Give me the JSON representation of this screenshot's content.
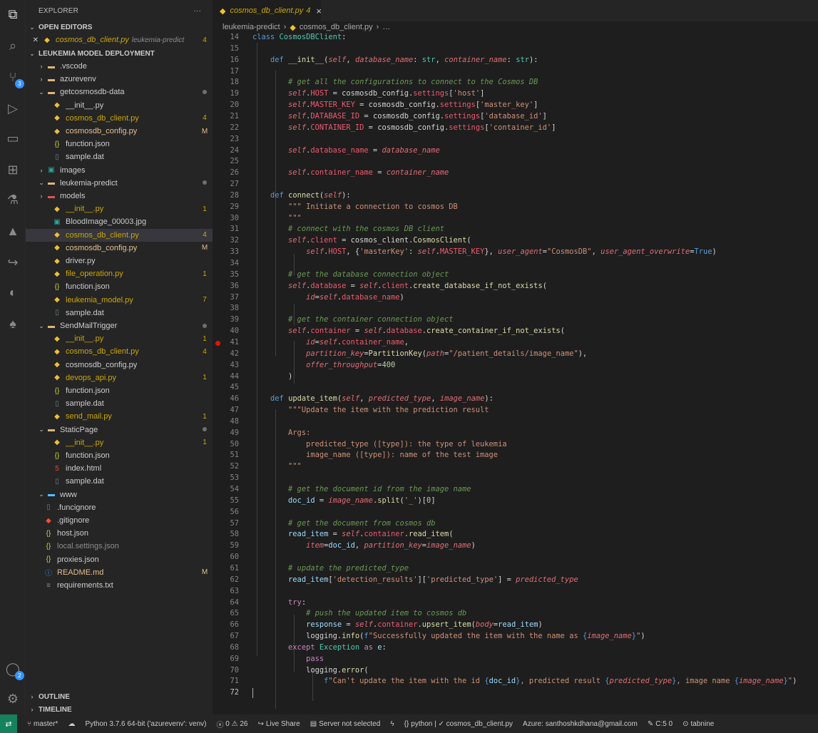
{
  "sidebar": {
    "title": "EXPLORER",
    "more": "···",
    "open_editors_label": "OPEN EDITORS",
    "open_editor": {
      "name": "cosmos_db_client.py",
      "desc": "leukemia-predict",
      "count": "4"
    },
    "project_label": "LEUKEMIA MODEL DEPLOYMENT",
    "outline_label": "OUTLINE",
    "timeline_label": "TIMELINE",
    "tree": [
      {
        "name": ".vscode",
        "type": "folder"
      },
      {
        "name": "azurevenv",
        "type": "folder"
      },
      {
        "name": "getcosmosdb-data",
        "type": "folder-open",
        "dec": "dot"
      },
      {
        "name": "__init__.py",
        "type": "py",
        "indent": 1
      },
      {
        "name": "cosmos_db_client.py",
        "type": "py",
        "indent": 1,
        "dec": "4"
      },
      {
        "name": "cosmosdb_config.py",
        "type": "py",
        "indent": 1,
        "dec": "M"
      },
      {
        "name": "function.json",
        "type": "json",
        "indent": 1
      },
      {
        "name": "sample.dat",
        "type": "file",
        "indent": 1
      },
      {
        "name": "images",
        "type": "img-folder"
      },
      {
        "name": "leukemia-predict",
        "type": "folder-open",
        "dec": "dot"
      },
      {
        "name": "models",
        "type": "red-folder",
        "indent": 1
      },
      {
        "name": "__init__.py",
        "type": "py",
        "indent": 1,
        "dec": "1"
      },
      {
        "name": "BloodImage_00003.jpg",
        "type": "img",
        "indent": 1
      },
      {
        "name": "cosmos_db_client.py",
        "type": "py",
        "indent": 1,
        "dec": "4",
        "sel": true
      },
      {
        "name": "cosmosdb_config.py",
        "type": "py",
        "indent": 1,
        "dec": "M"
      },
      {
        "name": "driver.py",
        "type": "py",
        "indent": 1
      },
      {
        "name": "file_operation.py",
        "type": "py",
        "indent": 1,
        "dec": "1"
      },
      {
        "name": "function.json",
        "type": "json",
        "indent": 1
      },
      {
        "name": "leukemia_model.py",
        "type": "py",
        "indent": 1,
        "dec": "7"
      },
      {
        "name": "sample.dat",
        "type": "file",
        "indent": 1
      },
      {
        "name": "SendMailTrigger",
        "type": "folder-open",
        "dec": "dot"
      },
      {
        "name": "__init__.py",
        "type": "py",
        "indent": 1,
        "dec": "1"
      },
      {
        "name": "cosmos_db_client.py",
        "type": "py",
        "indent": 1,
        "dec": "4"
      },
      {
        "name": "cosmosdb_config.py",
        "type": "py",
        "indent": 1
      },
      {
        "name": "devops_api.py",
        "type": "py",
        "indent": 1,
        "dec": "1"
      },
      {
        "name": "function.json",
        "type": "json",
        "indent": 1
      },
      {
        "name": "sample.dat",
        "type": "file",
        "indent": 1
      },
      {
        "name": "send_mail.py",
        "type": "py",
        "indent": 1,
        "dec": "1"
      },
      {
        "name": "StaticPage",
        "type": "folder-open",
        "dec": "dot"
      },
      {
        "name": "__init__.py",
        "type": "py",
        "indent": 1,
        "dec": "1"
      },
      {
        "name": "function.json",
        "type": "json",
        "indent": 1
      },
      {
        "name": "index.html",
        "type": "html",
        "indent": 1
      },
      {
        "name": "sample.dat",
        "type": "file",
        "indent": 1
      },
      {
        "name": "www",
        "type": "www-folder"
      },
      {
        "name": ".funcignore",
        "type": "file",
        "indent": 0
      },
      {
        "name": ".gitignore",
        "type": "git",
        "indent": 0
      },
      {
        "name": "host.json",
        "type": "json",
        "indent": 0
      },
      {
        "name": "local.settings.json",
        "type": "json",
        "indent": 0,
        "dim": true
      },
      {
        "name": "proxies.json",
        "type": "json",
        "indent": 0
      },
      {
        "name": "README.md",
        "type": "info",
        "indent": 0,
        "dec": "M"
      },
      {
        "name": "requirements.txt",
        "type": "txt",
        "indent": 0
      }
    ]
  },
  "tab": {
    "name": "cosmos_db_client.py",
    "count": "4",
    "close": "×"
  },
  "breadcrumb": {
    "folder": "leukemia-predict",
    "file": "cosmos_db_client.py",
    "rest": "…"
  },
  "activity_badges": {
    "scm": "3",
    "accounts": "2"
  },
  "editor": {
    "lines": [
      {
        "n": "14",
        "h": "<span class='kd'>class</span> <span class='cl'>CosmosDBClient</span>:"
      },
      {
        "n": "15",
        "h": ""
      },
      {
        "n": "16",
        "h": "    <span class='kd'>def</span> <span class='f'>__init__</span>(<span class='sf'>self</span>, <span class='p'>database_name</span>: <span class='cl'>str</span>, <span class='p'>container_name</span>: <span class='cl'>str</span>):"
      },
      {
        "n": "17",
        "h": ""
      },
      {
        "n": "18",
        "h": "        <span class='c'># get all the configurations to connect to the Cosmos DB</span>"
      },
      {
        "n": "19",
        "h": "        <span class='sf'>self</span>.<span class='pr'>HOST</span> = cosmosdb_config.<span class='pr'>settings</span>[<span class='s'>'host'</span>]"
      },
      {
        "n": "20",
        "h": "        <span class='sf'>self</span>.<span class='pr'>MASTER_KEY</span> = cosmosdb_config.<span class='pr'>settings</span>[<span class='s'>'master_key'</span>]"
      },
      {
        "n": "21",
        "h": "        <span class='sf'>self</span>.<span class='pr'>DATABASE_ID</span> = cosmosdb_config.<span class='pr'>settings</span>[<span class='s'>'database_id'</span>]"
      },
      {
        "n": "22",
        "h": "        <span class='sf'>self</span>.<span class='pr'>CONTAINER_ID</span> = cosmosdb_config.<span class='pr'>settings</span>[<span class='s'>'container_id'</span>]"
      },
      {
        "n": "23",
        "h": ""
      },
      {
        "n": "24",
        "h": "        <span class='sf'>self</span>.<span class='pr'>database_name</span> = <span class='p'>database_name</span>"
      },
      {
        "n": "25",
        "h": ""
      },
      {
        "n": "26",
        "h": "        <span class='sf'>self</span>.<span class='pr'>container_name</span> = <span class='p'>container_name</span>"
      },
      {
        "n": "27",
        "h": ""
      },
      {
        "n": "28",
        "h": "    <span class='kd'>def</span> <span class='f'>connect</span>(<span class='sf'>self</span>):"
      },
      {
        "n": "29",
        "h": "        <span class='s'>\"\"\" Initiate a connection to cosmos DB</span>"
      },
      {
        "n": "30",
        "h": "<span class='s'>        \"\"\"</span>"
      },
      {
        "n": "31",
        "h": "        <span class='c'># connect with the cosmos DB client</span>"
      },
      {
        "n": "32",
        "h": "        <span class='sf'>self</span>.<span class='pr'>client</span> = cosmos_client.<span class='f'>CosmosClient</span>("
      },
      {
        "n": "33",
        "h": "            <span class='sf'>self</span>.<span class='pr'>HOST</span>, {<span class='s'>'masterKey'</span>: <span class='sf'>self</span>.<span class='pr'>MASTER_KEY</span>}, <span class='p'>user_agent</span>=<span class='s'>\"CosmosDB\"</span>, <span class='p'>user_agent_overwrite</span>=<span class='kd'>True</span>)"
      },
      {
        "n": "34",
        "h": ""
      },
      {
        "n": "35",
        "h": "        <span class='c'># get the database connection object</span>"
      },
      {
        "n": "36",
        "h": "        <span class='sf'>self</span>.<span class='pr'>database</span> = <span class='sf'>self</span>.<span class='pr'>client</span>.<span class='f'>create_database_if_not_exists</span>("
      },
      {
        "n": "37",
        "h": "            <span class='p'>id</span>=<span class='sf'>self</span>.<span class='pr'>database_name</span>)"
      },
      {
        "n": "38",
        "h": ""
      },
      {
        "n": "39",
        "h": "        <span class='c'># get the container connection object</span>"
      },
      {
        "n": "40",
        "h": "        <span class='sf'>self</span>.<span class='pr'>container</span> = <span class='sf'>self</span>.<span class='pr'>database</span>.<span class='f'>create_container_if_not_exists</span>("
      },
      {
        "n": "41",
        "h": "            <span class='p'>id</span>=<span class='sf'>self</span>.<span class='pr'>container_name</span>,",
        "bp": true
      },
      {
        "n": "42",
        "h": "            <span class='p'>partition_key</span>=<span class='f'>PartitionKey</span>(<span class='p'>path</span>=<span class='s'>\"/patient_details/image_name\"</span>),"
      },
      {
        "n": "43",
        "h": "            <span class='p'>offer_throughput</span>=<span class='n'>400</span>"
      },
      {
        "n": "44",
        "h": "        )"
      },
      {
        "n": "45",
        "h": ""
      },
      {
        "n": "46",
        "h": "    <span class='kd'>def</span> <span class='f'>update_item</span>(<span class='sf'>self</span>, <span class='p'>predicted_type</span>, <span class='p'>image_name</span>):"
      },
      {
        "n": "47",
        "h": "        <span class='s'>\"\"\"Update the item with the prediction result</span>"
      },
      {
        "n": "48",
        "h": ""
      },
      {
        "n": "49",
        "h": "<span class='s'>        Args:</span>"
      },
      {
        "n": "50",
        "h": "<span class='s'>            predicted_type ([type]): the type of leukemia</span>"
      },
      {
        "n": "51",
        "h": "<span class='s'>            image_name ([type]): name of the test image</span>"
      },
      {
        "n": "52",
        "h": "<span class='s'>        \"\"\"</span>"
      },
      {
        "n": "53",
        "h": ""
      },
      {
        "n": "54",
        "h": "        <span class='c'># get the document id from the image name</span>"
      },
      {
        "n": "55",
        "h": "        <span class='v'>doc_id</span> = <span class='p'>image_name</span>.<span class='f'>split</span>(<span class='s'>'_'</span>)[<span class='n'>0</span>]"
      },
      {
        "n": "56",
        "h": ""
      },
      {
        "n": "57",
        "h": "        <span class='c'># get the document from cosmos db</span>"
      },
      {
        "n": "58",
        "h": "        <span class='v'>read_item</span> = <span class='sf'>self</span>.<span class='pr'>container</span>.<span class='f'>read_item</span>("
      },
      {
        "n": "59",
        "h": "            <span class='p'>item</span>=<span class='v'>doc_id</span>, <span class='p'>partition_key</span>=<span class='p'>image_name</span>)"
      },
      {
        "n": "60",
        "h": ""
      },
      {
        "n": "61",
        "h": "        <span class='c'># update the predicted_type</span>"
      },
      {
        "n": "62",
        "h": "        <span class='v'>read_item</span>[<span class='s'>'detection_results'</span>][<span class='s'>'predicted_type'</span>] = <span class='p'>predicted_type</span>"
      },
      {
        "n": "63",
        "h": ""
      },
      {
        "n": "64",
        "h": "        <span class='k'>try</span>:"
      },
      {
        "n": "65",
        "h": "            <span class='c'># push the updated item to cosmos db</span>"
      },
      {
        "n": "66",
        "h": "            <span class='v'>response</span> = <span class='sf'>self</span>.<span class='pr'>container</span>.<span class='f'>upsert_item</span>(<span class='p'>body</span>=<span class='v'>read_item</span>)"
      },
      {
        "n": "67",
        "h": "            logging.<span class='f'>info</span>(<span class='kd'>f</span><span class='s'>\"Successfully updated the item with the name as </span><span class='kd'>{</span><span class='p'>image_name</span><span class='kd'>}</span><span class='s'>\"</span>)"
      },
      {
        "n": "68",
        "h": "        <span class='k'>except</span> <span class='cl'>Exception</span> <span class='k'>as</span> <span class='v'>e</span>:"
      },
      {
        "n": "69",
        "h": "            <span class='k'>pass</span>"
      },
      {
        "n": "70",
        "h": "            logging.<span class='f'>error</span>("
      },
      {
        "n": "71",
        "h": "                <span class='kd'>f</span><span class='s'>\"Can't update the item with the id </span><span class='kd'>{</span><span class='v'>doc_id</span><span class='kd'>}</span><span class='s'>, predicted result </span><span class='kd'>{</span><span class='p'>predicted_type</span><span class='kd'>}</span><span class='s'>, image name </span><span class='kd'>{</span><span class='p'>image_name</span><span class='kd'>}</span><span class='s'>\"</span>)"
      },
      {
        "n": "72",
        "h": "",
        "cur": true
      }
    ]
  },
  "status": {
    "branch": "master*",
    "python": "Python 3.7.6 64-bit ('azurevenv': venv)",
    "errors": "0",
    "warnings": "26",
    "liveshare": "Live Share",
    "server": "Server not selected",
    "lang": "python | ✓ cosmos_db_client.py",
    "azure": "Azure: santhoshkdhana@gmail.com",
    "cs": "C:5 0",
    "tabnine": "tabnine"
  }
}
